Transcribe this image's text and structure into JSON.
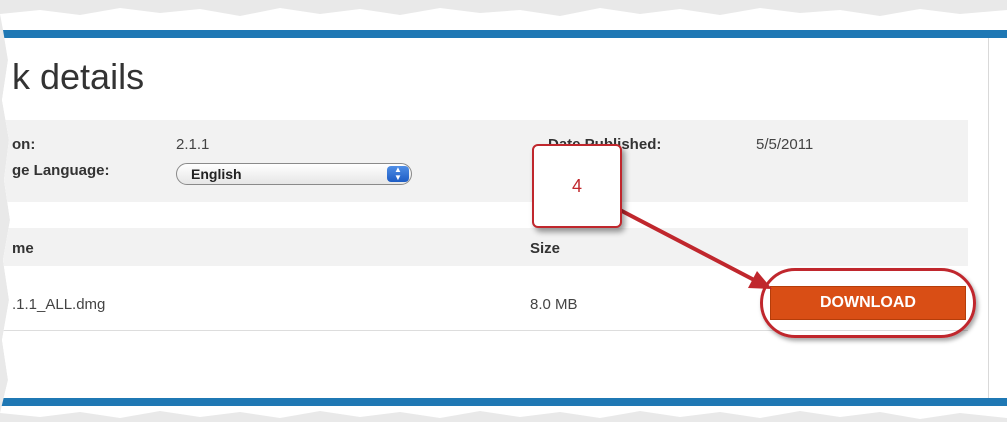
{
  "page": {
    "title": "k details"
  },
  "info": {
    "version_label": "on:",
    "version_value": "2.1.1",
    "language_label": "ge Language:",
    "language_selected": "English",
    "published_label": "Date Published:",
    "published_value": "5/5/2011"
  },
  "table": {
    "col_name": "me",
    "col_size": "Size",
    "rows": [
      {
        "name": ".1.1_ALL.dmg",
        "size": "8.0 MB"
      }
    ]
  },
  "actions": {
    "download_label": "DOWNLOAD"
  },
  "callout": {
    "number": "4"
  },
  "colors": {
    "brand_blue": "#1f78b4",
    "download_orange": "#d94e15",
    "callout_red": "#c0272d"
  },
  "icons": {
    "select_arrows": "up-down-chevron-icon"
  }
}
